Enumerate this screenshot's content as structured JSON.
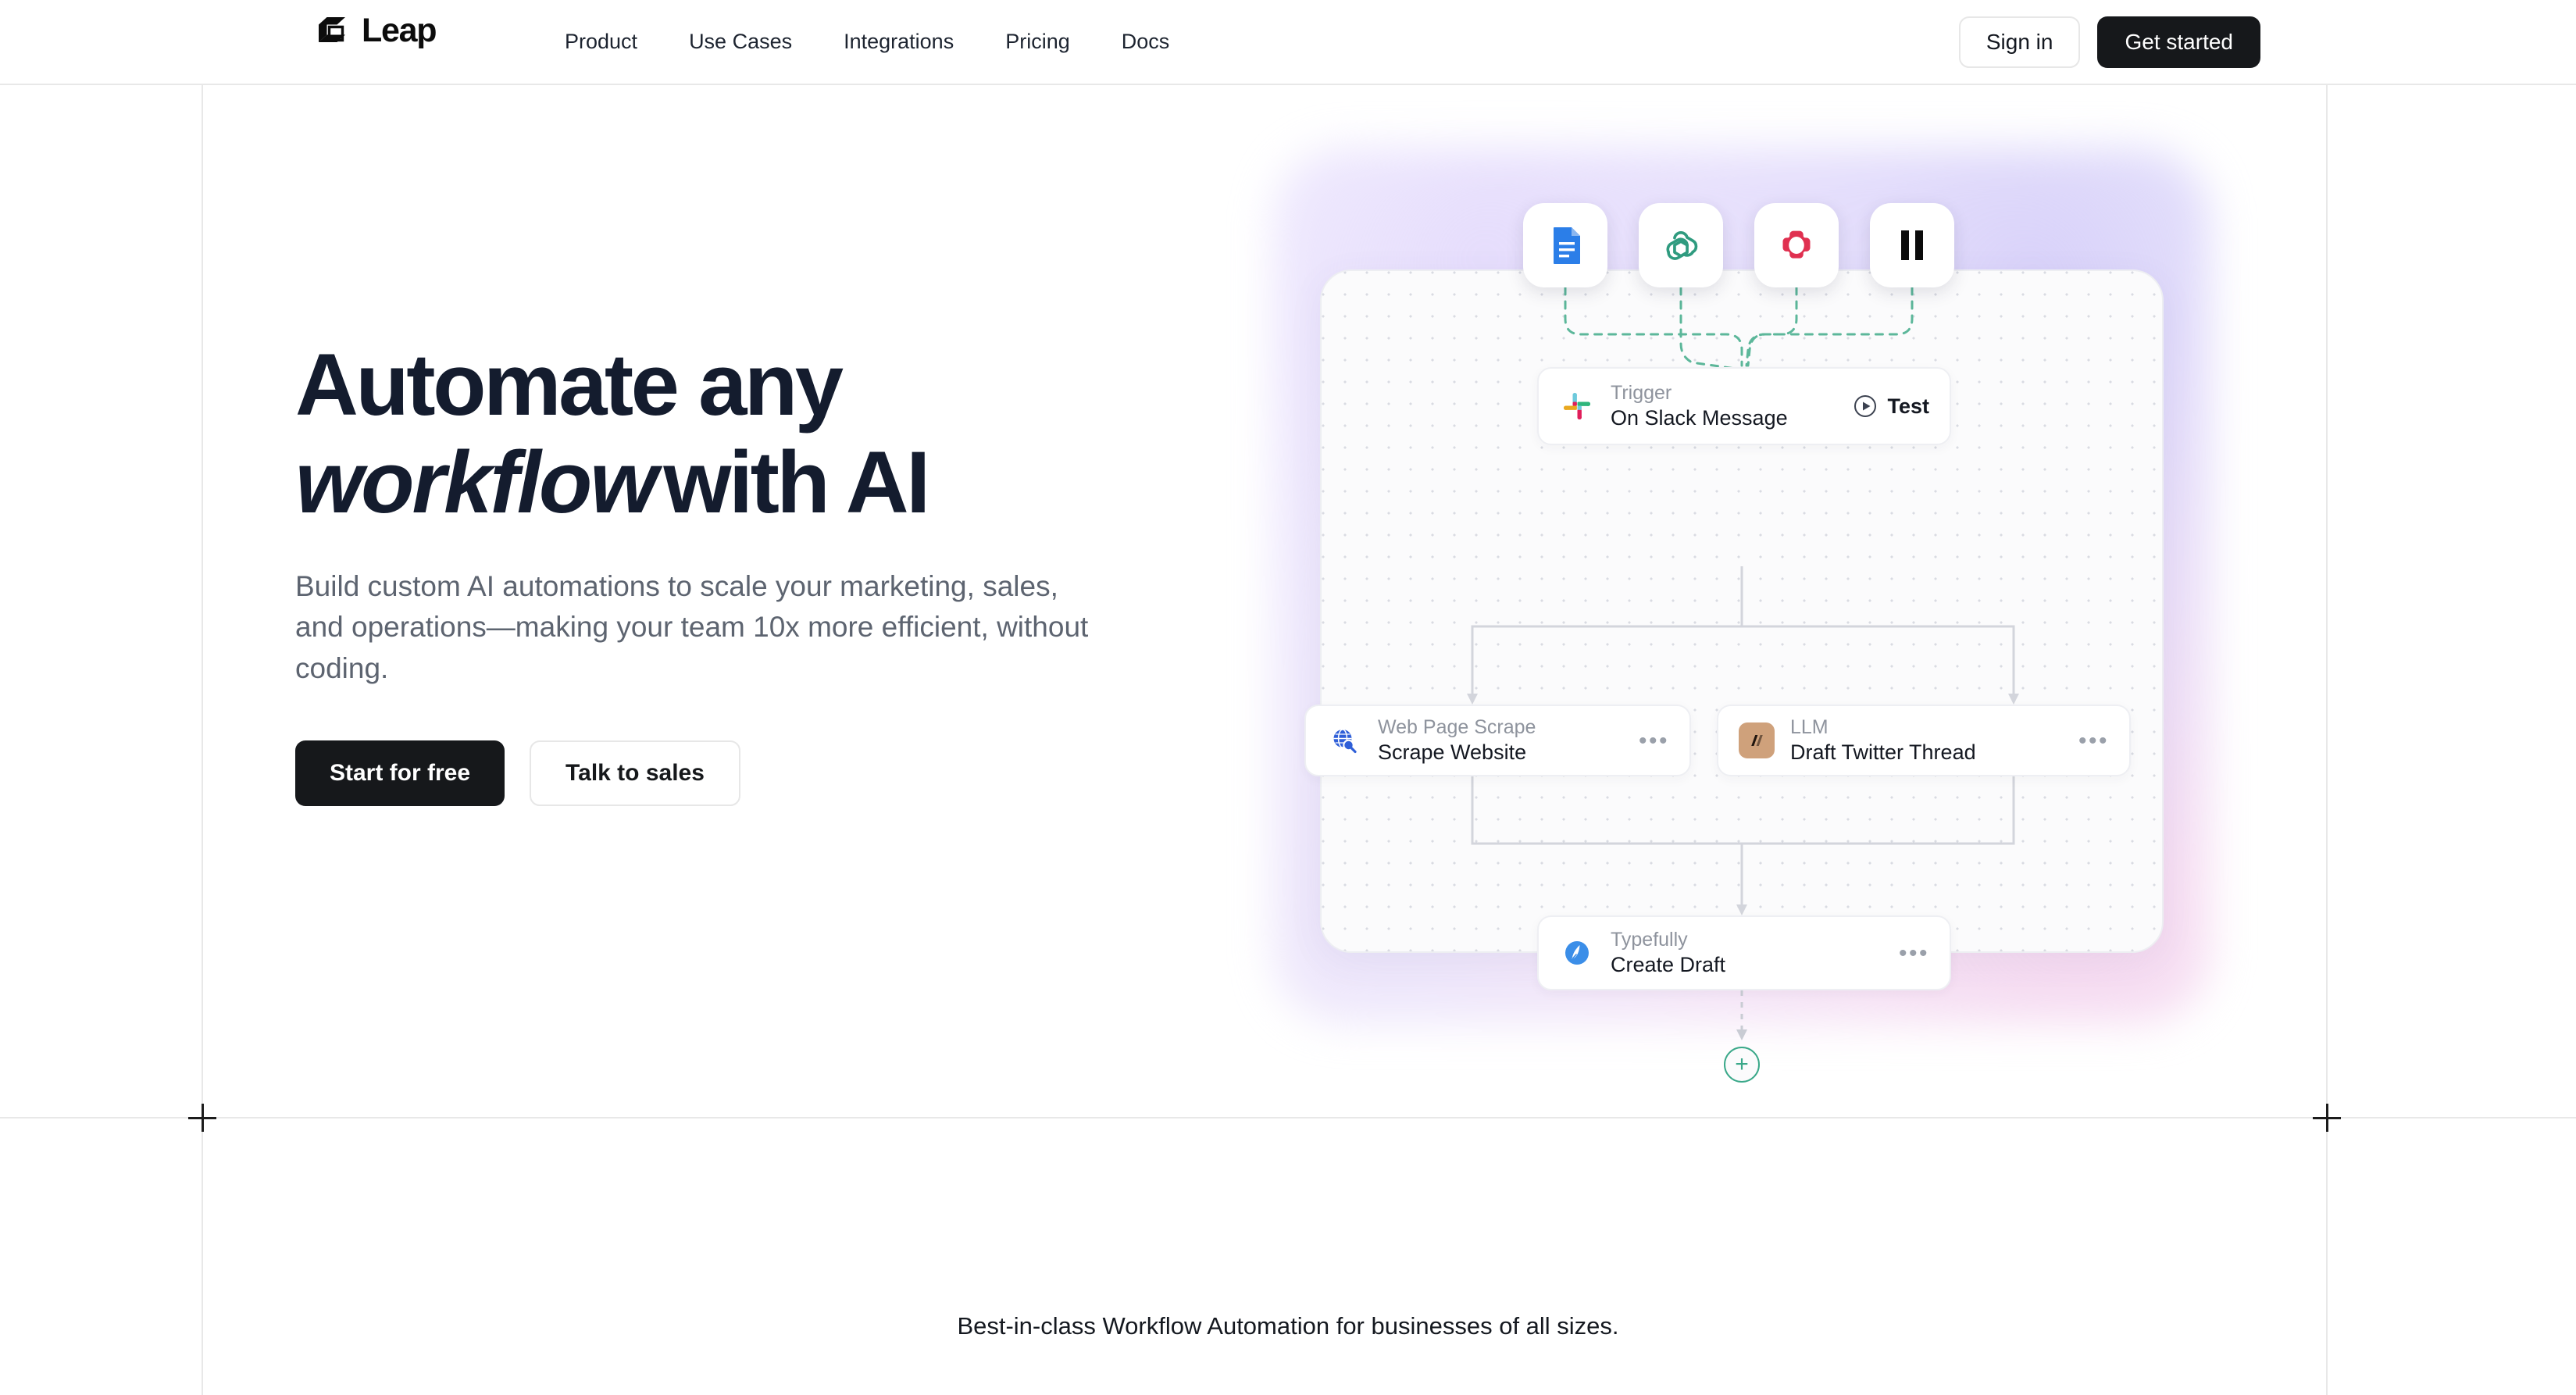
{
  "header": {
    "brand": {
      "name": "Leap",
      "logo_icon": "leap-cube-icon"
    },
    "nav": [
      {
        "label": "Product"
      },
      {
        "label": "Use Cases"
      },
      {
        "label": "Integrations"
      },
      {
        "label": "Pricing"
      },
      {
        "label": "Docs"
      }
    ],
    "sign_in_label": "Sign in",
    "get_started_label": "Get started"
  },
  "hero": {
    "title_line1": "Automate any",
    "title_emphasis": "workflow",
    "title_line2_rest": "with AI",
    "subtitle": "Build custom AI automations to scale your marketing, sales, and operations—making your team 10x more efficient, without coding.",
    "primary_cta": "Start for free",
    "secondary_cta": "Talk to sales"
  },
  "workflow": {
    "app_chips": [
      {
        "name": "google-docs-icon",
        "label": "Google Docs"
      },
      {
        "name": "openai-icon",
        "label": "OpenAI"
      },
      {
        "name": "hubspot-icon",
        "label": "HubSpot"
      },
      {
        "name": "pause-icon",
        "label": "Pause"
      }
    ],
    "nodes": [
      {
        "icon": "slack-icon",
        "kind": "Trigger",
        "name": "On Slack Message",
        "action_label": "Test",
        "action_icon": "play-circle-icon"
      },
      {
        "icon": "web-scrape-globe-icon",
        "kind": "Web Page Scrape",
        "name": "Scrape Website",
        "action_icon": "more-options-icon"
      },
      {
        "icon": "anthropic-icon",
        "kind": "LLM",
        "name": "Draft Twitter Thread",
        "action_icon": "more-options-icon"
      },
      {
        "icon": "typefully-icon",
        "kind": "Typefully",
        "name": "Create Draft",
        "action_icon": "more-options-icon"
      }
    ],
    "add_step_label": "+",
    "accent_color": "#3aa889"
  },
  "social_proof": {
    "text": "Best-in-class Workflow Automation for businesses of all sizes."
  },
  "colors": {
    "ink": "#141c2e",
    "muted": "#5d6470",
    "button_dark": "#16181b",
    "rule": "#e8e8e8",
    "teal": "#3aa889"
  }
}
